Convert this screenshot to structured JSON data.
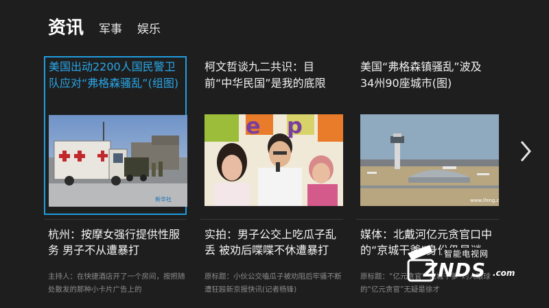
{
  "tabs": [
    {
      "label": "资讯",
      "active": true
    },
    {
      "label": "军事",
      "active": false
    },
    {
      "label": "娱乐",
      "active": false
    }
  ],
  "columns": [
    {
      "headline": "美国出动2200人国民警卫队应对“弗格森骚乱”(组图)",
      "image_watermark": "新华社",
      "sub_title": "杭州：按摩女强行提供性服务 男子不从遭暴打",
      "summary": "主持人：在快捷酒店开了一个房间，按照随处散发的那种小卡片广告上的"
    },
    {
      "headline": "柯文哲谈九二共识：目前“中华民国”是我的底限",
      "sub_title": "实拍：男子公交上吃瓜子乱丢 被劝后喋喋不休遭暴打",
      "summary": "原标题：小伙公交嗑瓜子被劝阻后牢骚不断遭狂殴新京报快讯(记者杨锋)"
    },
    {
      "headline": "美国“弗格森镇骚乱”波及34州90座城市(图)",
      "image_watermark": "www.ifeng.com",
      "sub_title": "媒体：北戴河亿元贪官口中的“京城干爹”身份仍是谜",
      "summary": "原标题：“亿元贪官”“京城干爹”灼人眼球的“亿元贪官”无疑是徐才"
    }
  ],
  "logo": {
    "small": "智能电视网",
    "big": "ZNDS",
    "suffix": ".com"
  },
  "colors": {
    "background": "#1e1e1e",
    "accent": "#1f9ee0",
    "summary_text": "#8c8c8c"
  },
  "icons": {
    "next": "chevron-right-icon"
  }
}
